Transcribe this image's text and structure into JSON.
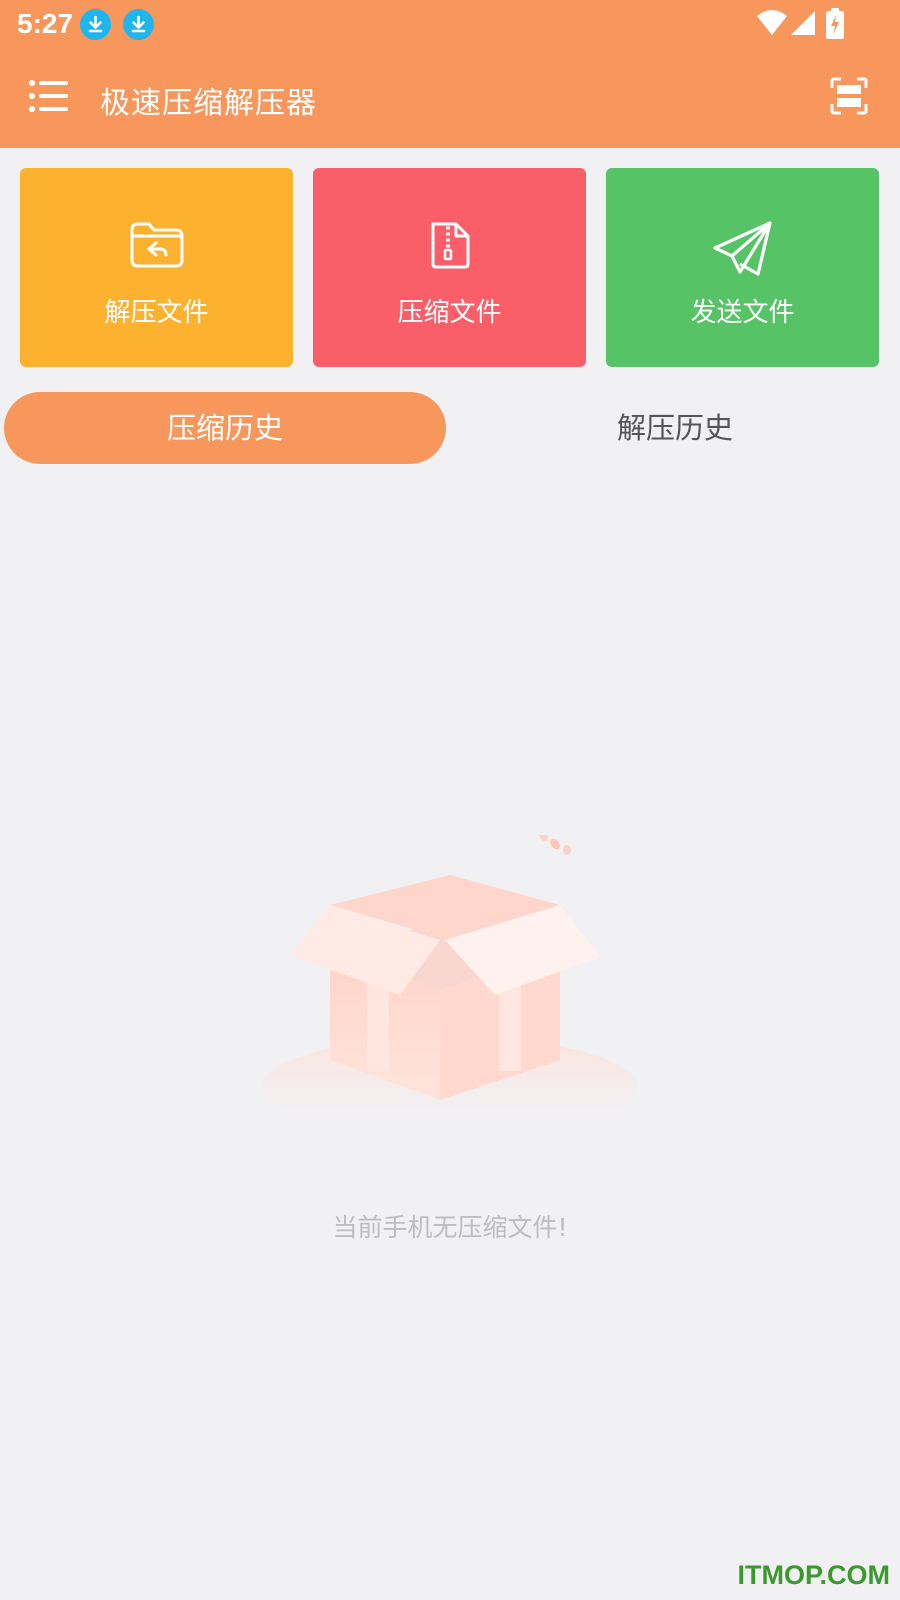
{
  "status_bar": {
    "time": "5:27"
  },
  "app_bar": {
    "title": "极速压缩解压器"
  },
  "actions": {
    "extract_label": "解压文件",
    "compress_label": "压缩文件",
    "send_label": "发送文件"
  },
  "tabs": [
    {
      "label": "压缩历史",
      "active": true
    },
    {
      "label": "解压历史",
      "active": false
    }
  ],
  "empty_state": {
    "message": "当前手机无压缩文件!"
  },
  "watermark": "ITMOP.COM",
  "colors": {
    "primary": "#f7975c",
    "extract": "#fcb22f",
    "compress": "#fa5e69",
    "send": "#56c366",
    "background": "#f1f1f4"
  },
  "icons": [
    "download-icon",
    "wifi-icon",
    "signal-icon",
    "battery-icon",
    "menu-icon",
    "scan-icon",
    "folder-return-icon",
    "zip-file-icon",
    "paper-plane-icon",
    "empty-box-icon"
  ]
}
